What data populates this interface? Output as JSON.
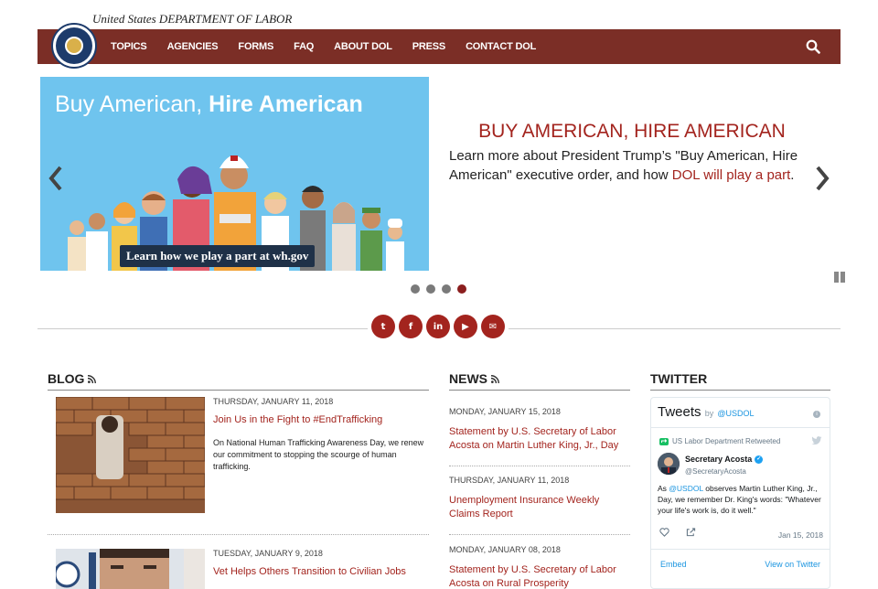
{
  "header": {
    "dept_name": "United States DEPARTMENT OF LABOR",
    "nav": [
      "TOPICS",
      "AGENCIES",
      "FORMS",
      "FAQ",
      "ABOUT DOL",
      "PRESS",
      "CONTACT DOL"
    ],
    "search_icon": "search-icon",
    "nav_color": "#7b2e26"
  },
  "slider": {
    "image_title_light": "Buy American, ",
    "image_title_bold": "Hire American",
    "image_banner": "Learn how we play a part at wh.gov",
    "title": "BUY AMERICAN, HIRE AMERICAN",
    "text_before_link": "Learn more about President Trump’s \"Buy American, Hire American\" executive order, and how ",
    "text_link": "DOL will play a part",
    "text_after_link": ".",
    "active_dot": 4,
    "dot_count": 4,
    "accent_color": "#a3241e"
  },
  "social": [
    "twitter-icon",
    "facebook-icon",
    "linkedin-icon",
    "youtube-icon",
    "email-icon"
  ],
  "blog": {
    "heading": "BLOG",
    "posts": [
      {
        "date": "THURSDAY, JANUARY 11, 2018",
        "title": "Join Us in the Fight to #EndTrafficking",
        "description": "On National Human Trafficking Awareness Day, we renew our commitment to stopping the scourge of human trafficking."
      },
      {
        "date": "TUESDAY, JANUARY 9, 2018",
        "title": "Vet Helps Others Transition to Civilian Jobs",
        "description": ""
      }
    ]
  },
  "news": {
    "heading": "NEWS",
    "items": [
      {
        "date": "MONDAY, JANUARY 15, 2018",
        "title": "Statement by U.S. Secretary of Labor Acosta on Martin Luther King, Jr., Day"
      },
      {
        "date": "THURSDAY, JANUARY 11, 2018",
        "title": "Unemployment Insurance Weekly Claims Report"
      },
      {
        "date": "MONDAY, JANUARY 08, 2018",
        "title": "Statement by U.S. Secretary of Labor Acosta on Rural Prosperity"
      }
    ]
  },
  "twitter": {
    "heading": "TWITTER",
    "widget_title": "Tweets",
    "by": "by",
    "handle": "@USDOL",
    "retweet_note": "US Labor Department Retweeted",
    "tweet_author": "Secretary Acosta",
    "tweet_user": "@SecretaryAcosta",
    "tweet_prefix": "As ",
    "tweet_mention": "@USDOL",
    "tweet_body": " observes Martin Luther King, Jr., Day, we remember Dr. King's words: \"Whatever your life's work is, do it well.\"",
    "tweet_date": "Jan 15, 2018",
    "embed": "Embed",
    "view_on": "View on Twitter"
  }
}
